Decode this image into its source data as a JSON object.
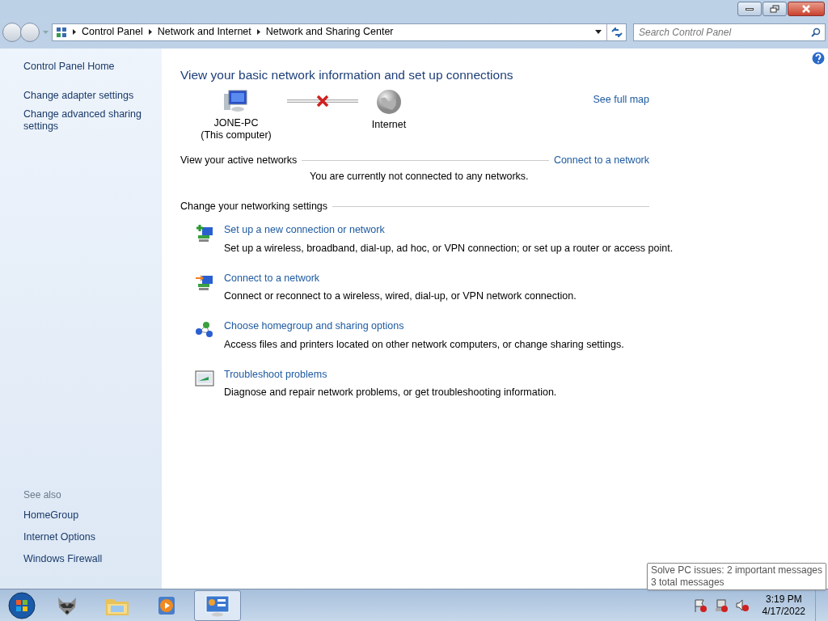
{
  "address_bar": {
    "breadcrumbs": [
      "Control Panel",
      "Network and Internet",
      "Network and Sharing Center"
    ]
  },
  "search": {
    "placeholder": "Search Control Panel"
  },
  "sidebar": {
    "items": [
      "Control Panel Home",
      "Change adapter settings",
      "Change advanced sharing settings"
    ],
    "see_also_title": "See also",
    "see_also": [
      "HomeGroup",
      "Internet Options",
      "Windows Firewall"
    ]
  },
  "main": {
    "heading": "View your basic network information and set up connections",
    "see_full_map": "See full map",
    "map": {
      "connected": false,
      "nodes": [
        {
          "kind": "computer",
          "label": "JONE-PC",
          "sublabel": "(This computer)"
        },
        {
          "kind": "internet",
          "label": "Internet"
        }
      ]
    },
    "active_networks": {
      "title": "View your active networks",
      "link": "Connect to a network",
      "message": "You are currently not connected to any networks."
    },
    "settings": {
      "title": "Change your networking settings",
      "tasks": [
        {
          "kind": "new-connection",
          "title": "Set up a new connection or network",
          "description": "Set up a wireless, broadband, dial-up, ad hoc, or VPN connection; or set up a router or access point."
        },
        {
          "kind": "connect",
          "title": "Connect to a network",
          "description": "Connect or reconnect to a wireless, wired, dial-up, or VPN network connection."
        },
        {
          "kind": "homegroup",
          "title": "Choose homegroup and sharing options",
          "description": "Access files and printers located on other network computers, or change sharing settings."
        },
        {
          "kind": "troubleshoot",
          "title": "Troubleshoot problems",
          "description": "Diagnose and repair network problems, or get troubleshooting information."
        }
      ]
    }
  },
  "tooltip": {
    "lines": [
      "Solve PC issues: 2 important messages",
      "3 total messages"
    ]
  },
  "taskbar": {
    "apps": [
      {
        "kind": "animal",
        "selected": false
      },
      {
        "kind": "folder",
        "selected": false
      },
      {
        "kind": "media",
        "selected": false
      },
      {
        "kind": "control-panel",
        "selected": true
      }
    ],
    "clock": {
      "time": "3:19 PM",
      "date": "4/17/2022"
    }
  }
}
